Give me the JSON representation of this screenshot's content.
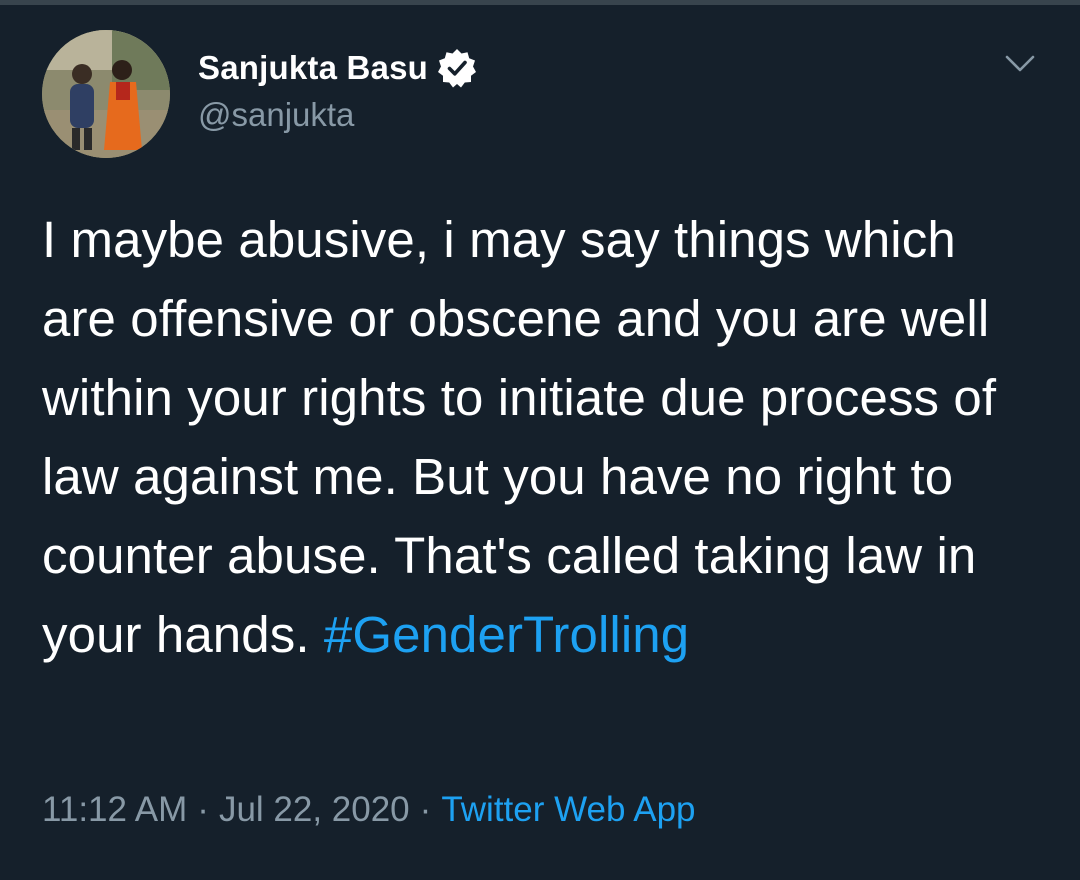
{
  "tweet": {
    "author": {
      "display_name": "Sanjukta Basu",
      "handle": "@sanjukta",
      "verified_icon": "verified-badge-icon",
      "avatar": "profile-photo"
    },
    "menu_icon": "chevron-down-icon",
    "text_parts": {
      "body": "I maybe abusive, i may say things which are offensive or obscene and you are well within your rights to initiate due process of law against me. But you have no right to counter abuse. That's called taking law in your hands.",
      "hashtag": "#GenderTrolling"
    },
    "time": "11:12 AM",
    "separator": "·",
    "date": "Jul 22, 2020",
    "source": "Twitter Web App"
  },
  "colors": {
    "background": "#15202b",
    "text": "#ffffff",
    "secondary_text": "#8899a6",
    "link": "#1da1f2"
  }
}
